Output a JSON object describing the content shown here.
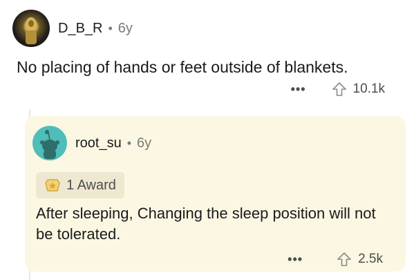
{
  "comment": {
    "username": "D_B_R",
    "separator": "•",
    "age": "6y",
    "text": "No placing of hands or feet outside of blankets.",
    "more_label": "•••",
    "upvotes": "10.1k",
    "avatar_icon": "user-avatar-photo"
  },
  "reply": {
    "username": "root_su",
    "separator": "•",
    "age": "6y",
    "award_label": "1 Award",
    "award_icon": "award-icon",
    "text": "After sleeping, Changing the sleep position will not be tolerated.",
    "more_label": "•••",
    "upvotes": "2.5k",
    "avatar_icon": "snoo-avatar-icon",
    "card_color": "#fcf7e2",
    "avatar_color": "#4fbdba"
  }
}
